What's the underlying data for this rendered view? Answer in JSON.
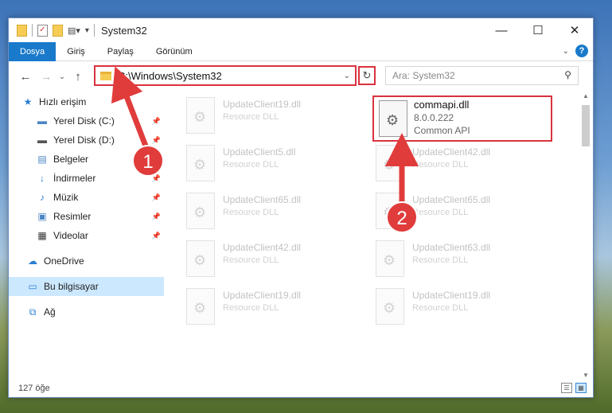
{
  "window": {
    "title": "System32"
  },
  "ribbon": {
    "tabs": [
      "Dosya",
      "Giriş",
      "Paylaş",
      "Görünüm"
    ],
    "help": "?"
  },
  "nav": {
    "address": "C:\\Windows\\System32",
    "search_placeholder": "Ara: System32"
  },
  "sidebar": {
    "quick_access": "Hızlı erişim",
    "items": [
      {
        "label": "Yerel Disk (C:)"
      },
      {
        "label": "Yerel Disk (D:)"
      },
      {
        "label": "Belgeler"
      },
      {
        "label": "İndirmeler"
      },
      {
        "label": "Müzik"
      },
      {
        "label": "Resimler"
      },
      {
        "label": "Videolar"
      }
    ],
    "onedrive": "OneDrive",
    "this_pc": "Bu bilgisayar",
    "network": "Ağ"
  },
  "files": [
    {
      "name": "UpdateClient19.dll",
      "desc": "Resource DLL"
    },
    {
      "name": "UpdateClient42.dll",
      "desc": "Resource DLL"
    },
    {
      "name": "UpdateClient5.dll",
      "desc": "Resource DLL"
    },
    {
      "name": "UpdateClient65.dll",
      "desc": "Resource DLL"
    },
    {
      "name": "UpdateClient65.dll",
      "desc": "Resource DLL"
    },
    {
      "name": "UpdateClient42.dll",
      "desc": "Resource DLL"
    },
    {
      "name": "UpdateClient63.dll",
      "desc": "Resource DLL"
    },
    {
      "name": "UpdateClient19.dll",
      "desc": "Resource DLL"
    },
    {
      "name": "UpdateClient19.dll",
      "desc": "Resource DLL"
    }
  ],
  "highlighted_file": {
    "name": "commapi.dll",
    "version": "8.0.0.222",
    "desc": "Common API"
  },
  "status": {
    "count": "127 öğe"
  },
  "annotations": {
    "step1": "1",
    "step2": "2",
    "color": "#e03c3c"
  }
}
